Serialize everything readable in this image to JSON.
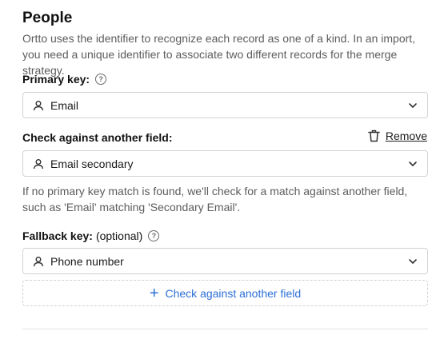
{
  "section": {
    "title": "People",
    "description": "Ortto uses the identifier to recognize each record as one of a kind. In an import, you need a unique identifier to associate two different records for the merge strategy."
  },
  "primary_key": {
    "label": "Primary key:",
    "help": "?",
    "value": "Email"
  },
  "check_field": {
    "label": "Check against another field:",
    "remove_label": "Remove",
    "value": "Email secondary",
    "helper": "If no primary key match is found, we'll check for a match against another field, such as 'Email' matching 'Secondary Email'."
  },
  "fallback_key": {
    "label": "Fallback key:",
    "optional": "(optional)",
    "help": "?",
    "value": "Phone number"
  },
  "add_check": {
    "icon": "+",
    "label": "Check against another field"
  },
  "colors": {
    "accent": "#2b6fd6",
    "text": "#1a1a1a",
    "muted": "#5c5c5c",
    "border": "#d2d2d2"
  }
}
